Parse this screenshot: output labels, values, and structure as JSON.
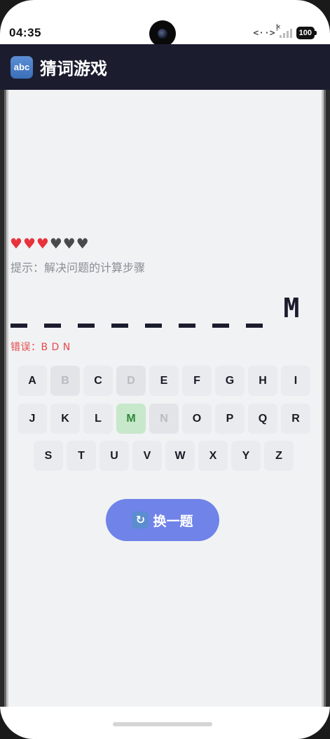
{
  "status": {
    "time": "04:35",
    "data_icon": "<··>",
    "battery": "100"
  },
  "header": {
    "logo_text": "abc",
    "title": "猜词游戏"
  },
  "game": {
    "lives_total": 6,
    "lives_remaining": 3,
    "hint": "提示：解决问题的计算步骤",
    "word_slots": [
      "",
      "",
      "",
      "",
      "",
      "",
      "",
      "",
      "M"
    ],
    "errors": "错误：B D N"
  },
  "keyboard": {
    "rows": [
      [
        "A",
        "B",
        "C",
        "D",
        "E",
        "F",
        "G",
        "H",
        "I"
      ],
      [
        "J",
        "K",
        "L",
        "M",
        "N",
        "O",
        "P",
        "Q",
        "R"
      ],
      [
        "S",
        "T",
        "U",
        "V",
        "W",
        "X",
        "Y",
        "Z"
      ]
    ],
    "used_wrong": [
      "B",
      "D",
      "N"
    ],
    "used_correct": [
      "M"
    ]
  },
  "actions": {
    "new_word_label": "换一题"
  },
  "colors": {
    "header_bg": "#1b1d2e",
    "button_bg": "#6f83e8",
    "error_text": "#e64a4a",
    "correct_key_bg": "#c8e8cb"
  }
}
